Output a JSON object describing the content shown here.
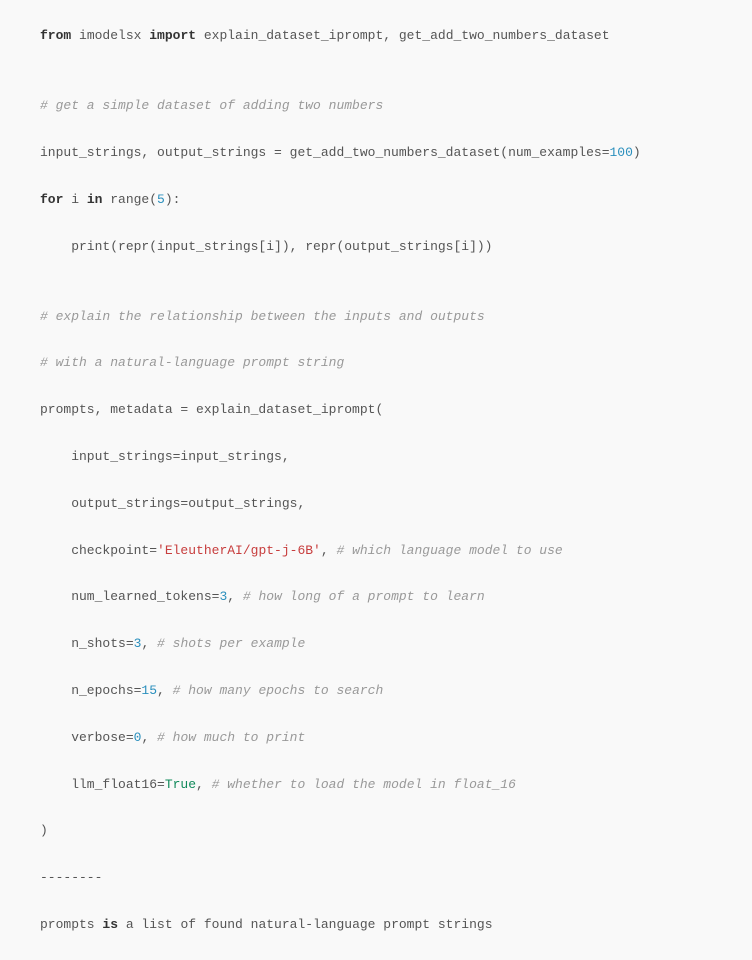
{
  "code": {
    "l1_from": "from",
    "l1_module": " imodelsx ",
    "l1_import": "import",
    "l1_rest": " explain_dataset_iprompt, get_add_two_numbers_dataset",
    "l3_comment": "# get a simple dataset of adding two numbers",
    "l4_lhs": "input_strings, output_strings = get_add_two_numbers_dataset(num_examples=",
    "l4_num": "100",
    "l4_close": ")",
    "l5_for": "for",
    "l5_mid": " i ",
    "l5_in": "in",
    "l5_range": " range(",
    "l5_num": "5",
    "l5_close": "):",
    "l6_body": "    print(repr(input_strings[i]), repr(output_strings[i]))",
    "l8_comment": "# explain the relationship between the inputs and outputs",
    "l9_comment": "# with a natural-language prompt string",
    "l10": "prompts, metadata = explain_dataset_iprompt(",
    "l11": "    input_strings=input_strings,",
    "l12": "    output_strings=output_strings,",
    "l13a": "    checkpoint=",
    "l13_str": "'EleutherAI/gpt-j-6B'",
    "l13b": ", ",
    "l13_comment": "# which language model to use",
    "l14a": "    num_learned_tokens=",
    "l14_num": "3",
    "l14b": ", ",
    "l14_comment": "# how long of a prompt to learn",
    "l15a": "    n_shots=",
    "l15_num": "3",
    "l15b": ", ",
    "l15_comment": "# shots per example",
    "l16a": "    n_epochs=",
    "l16_num": "15",
    "l16b": ", ",
    "l16_comment": "# how many epochs to search",
    "l17a": "    verbose=",
    "l17_num": "0",
    "l17b": ", ",
    "l17_comment": "# how much to print",
    "l18a": "    llm_float16=",
    "l18_bool": "True",
    "l18b": ", ",
    "l18_comment": "# whether to load the model in float_16",
    "l19": ")",
    "l20": "--------",
    "l21a": "prompts ",
    "l21_is": "is",
    "l21b": " a list of found natural-language prompt strings"
  }
}
